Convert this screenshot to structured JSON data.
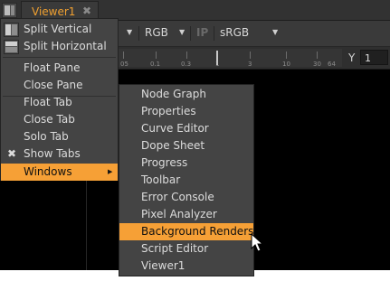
{
  "window": {
    "tab_label": "Viewer1",
    "tab_close": "✖"
  },
  "toolbar": {
    "channels_value": "RGB",
    "ip_label": "IP",
    "colorspace_value": "sRGB",
    "dropdown_arrow": "▼"
  },
  "ruler": {
    "ticks": [
      "05",
      "0.1",
      "0.3",
      "1",
      "3",
      "10",
      "30",
      "64"
    ],
    "y_label": "Y",
    "y_value": "1"
  },
  "context_menu": {
    "items": [
      {
        "label": "Split Vertical",
        "icon": "split-vertical-icon"
      },
      {
        "label": "Split Horizontal",
        "icon": "split-horizontal-icon"
      },
      {
        "label": "Float Pane"
      },
      {
        "label": "Close Pane"
      },
      {
        "label": "Float Tab"
      },
      {
        "label": "Close Tab"
      },
      {
        "label": "Solo Tab"
      },
      {
        "label": "Show Tabs",
        "checked_mark": "✖"
      },
      {
        "label": "Windows",
        "submenu_arrow": "▶",
        "highlighted": true
      }
    ]
  },
  "windows_submenu": {
    "items": [
      "Node Graph",
      "Properties",
      "Curve Editor",
      "Dope Sheet",
      "Progress",
      "Toolbar",
      "Error Console",
      "Pixel Analyzer",
      "Background Renders",
      "Script Editor",
      "Viewer1"
    ],
    "highlighted_item": "Background Renders"
  },
  "colors": {
    "highlight": "#f6a036",
    "tab_text": "#f0a030",
    "menu_bg": "#444444"
  }
}
